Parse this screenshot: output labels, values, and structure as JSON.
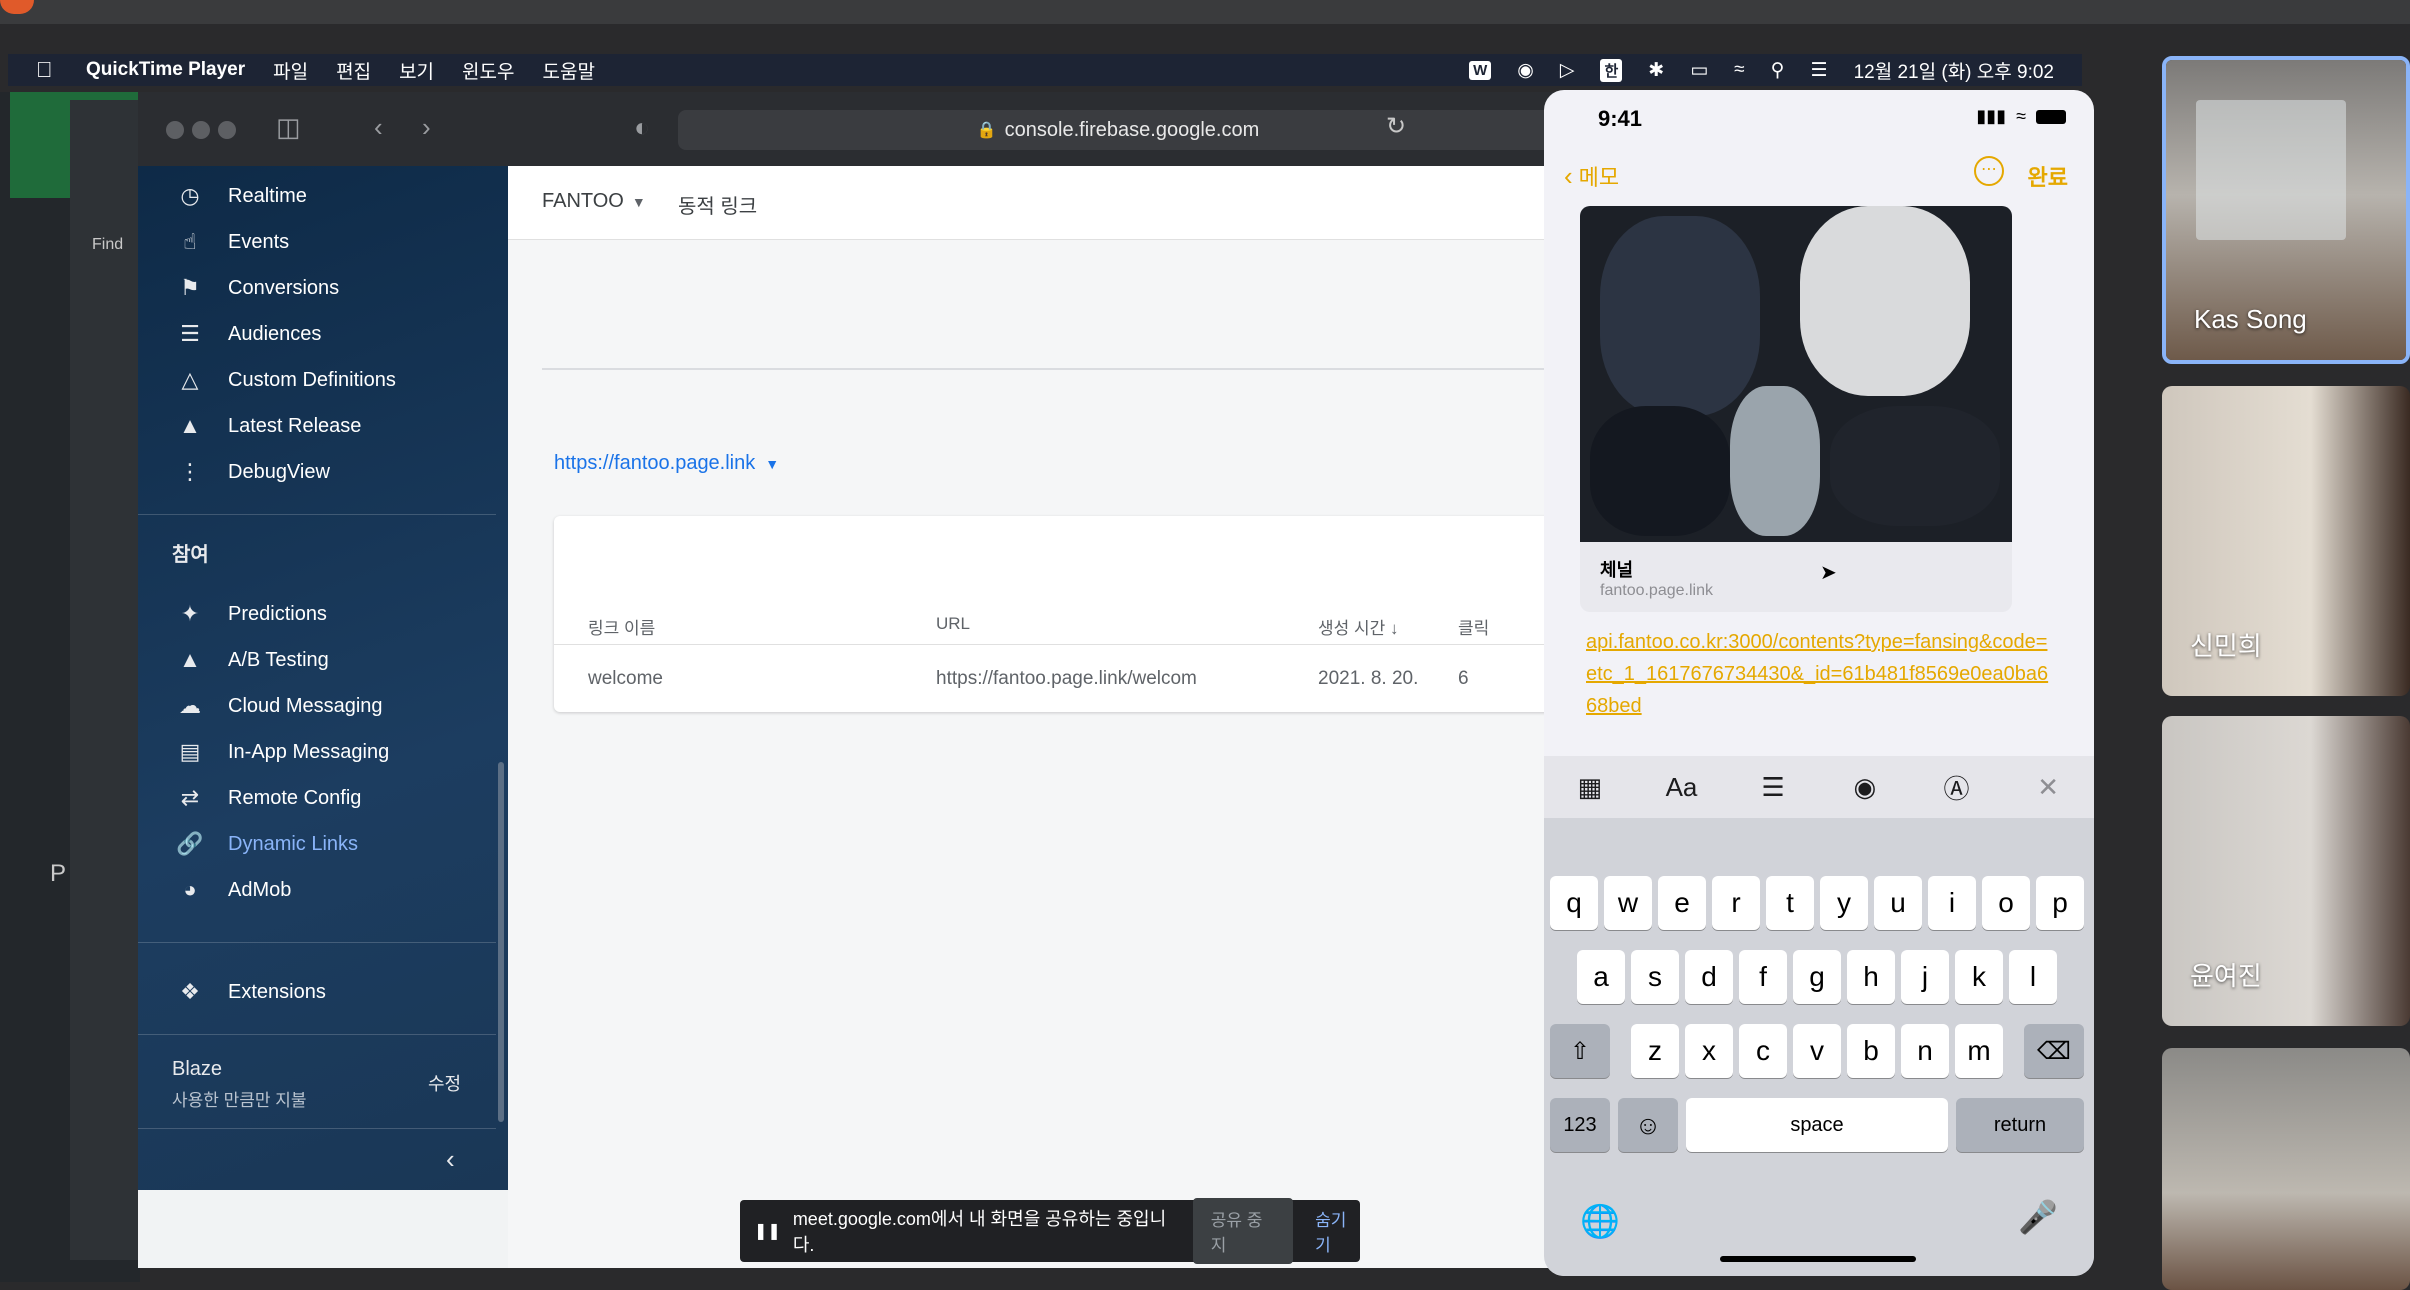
{
  "menubar": {
    "app_name": "QuickTime Player",
    "menus": [
      "파일",
      "편집",
      "보기",
      "윈도우",
      "도움말"
    ],
    "clock": "12월 21일 (화) 오후 9:02"
  },
  "background": {
    "find_label": "Find"
  },
  "browser": {
    "url": "console.firebase.google.com"
  },
  "sidebar": {
    "analytics_items": [
      {
        "label": "Realtime",
        "icon": "clock-icon"
      },
      {
        "label": "Events",
        "icon": "touch-icon"
      },
      {
        "label": "Conversions",
        "icon": "flag-icon"
      },
      {
        "label": "Audiences",
        "icon": "audience-icon"
      },
      {
        "label": "Custom Definitions",
        "icon": "shapes-icon"
      },
      {
        "label": "Latest Release",
        "icon": "rocket-icon"
      },
      {
        "label": "DebugView",
        "icon": "debug-icon"
      }
    ],
    "engage_section": "참여",
    "engage_items": [
      {
        "label": "Predictions",
        "icon": "wand-icon"
      },
      {
        "label": "A/B Testing",
        "icon": "flask-icon"
      },
      {
        "label": "Cloud Messaging",
        "icon": "cloud-icon"
      },
      {
        "label": "In-App Messaging",
        "icon": "inapp-icon"
      },
      {
        "label": "Remote Config",
        "icon": "config-icon"
      },
      {
        "label": "Dynamic Links",
        "icon": "link-icon",
        "active": true
      },
      {
        "label": "AdMob",
        "icon": "admob-icon"
      }
    ],
    "extensions_label": "Extensions",
    "plan_name": "Blaze",
    "plan_desc": "사용한 만큼만 지불",
    "plan_edit": "수정"
  },
  "main": {
    "project": "FANTOO",
    "breadcrumb": "동적 링크",
    "domain": "https://fantoo.page.link",
    "table": {
      "headers": [
        "링크 이름",
        "URL",
        "생성 시간",
        "클릭"
      ],
      "rows": [
        [
          "welcome",
          "https://fantoo.page.link/welcom",
          "2021. 8. 20.",
          "6"
        ]
      ]
    }
  },
  "sharebar": {
    "message": "meet.google.com에서 내 화면을 공유하는 중입니다.",
    "stop_label": "공유 중지",
    "hide_label": "숨기기"
  },
  "phone": {
    "time": "9:41",
    "back_label": "메모",
    "done_label": "완료",
    "link_card_title": "체널",
    "link_card_domain": "fantoo.page.link",
    "body_url": "api.fantoo.co.kr:3000/contents?type=fansing&code=etc_1_1617676734430&_id=61b481f8569e0ea0ba668bed",
    "keyboard": {
      "row1": [
        "q",
        "w",
        "e",
        "r",
        "t",
        "y",
        "u",
        "i",
        "o",
        "p"
      ],
      "row2": [
        "a",
        "s",
        "d",
        "f",
        "g",
        "h",
        "j",
        "k",
        "l"
      ],
      "row3": [
        "z",
        "x",
        "c",
        "v",
        "b",
        "n",
        "m"
      ],
      "numbers": "123",
      "space": "space",
      "return": "return"
    }
  },
  "participants": [
    {
      "name": "Kas Song"
    },
    {
      "name": "신민희"
    },
    {
      "name": "윤여진"
    },
    {
      "name": ""
    }
  ],
  "colors": {
    "firebase_nav": "#1a3756",
    "active_link": "#8ab4f8",
    "notes_accent": "#e5a800"
  }
}
